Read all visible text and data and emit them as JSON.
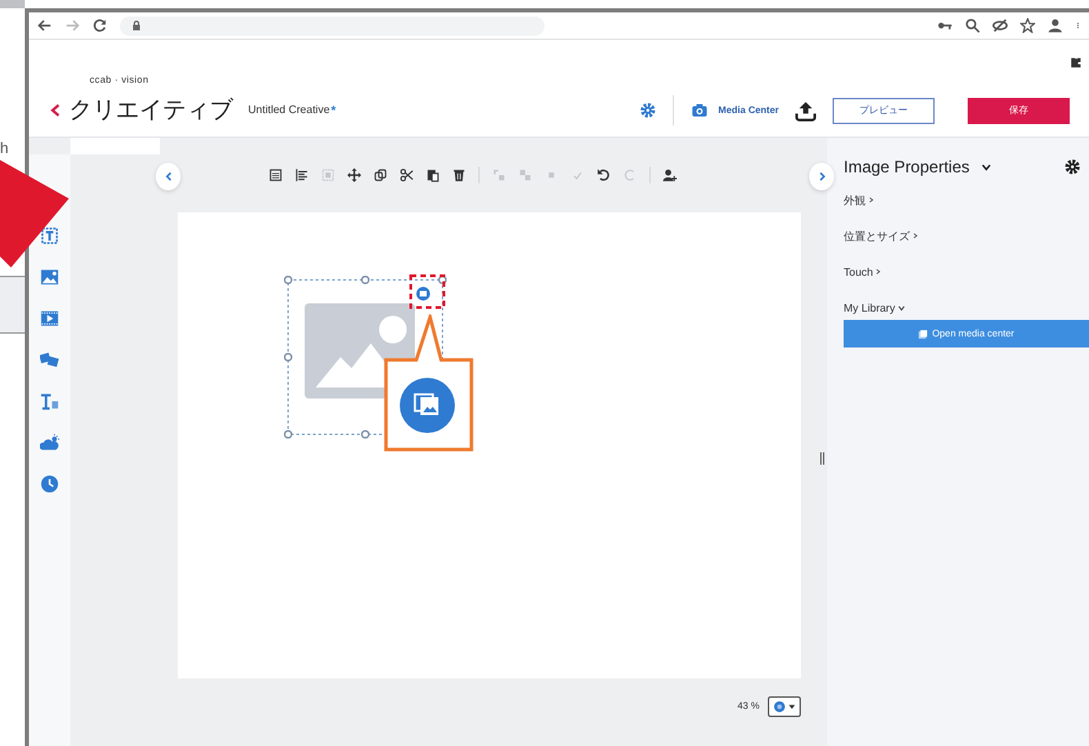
{
  "backdrop": {
    "text": "h"
  },
  "app_header": {
    "logo": "ccab · vision",
    "title": "クリエイティブ",
    "document_name": "Untitled Creative",
    "unsaved_mark": "*",
    "media_center": "Media Center",
    "preview_button": "プレビュー",
    "save_button": "保存"
  },
  "toolbar": {
    "tools": [
      {
        "kind": "list",
        "disabled": false
      },
      {
        "kind": "align",
        "disabled": false
      },
      {
        "kind": "group",
        "disabled": true
      },
      {
        "kind": "move",
        "disabled": false
      },
      {
        "kind": "copy",
        "disabled": false
      },
      {
        "kind": "cut",
        "disabled": false
      },
      {
        "kind": "paste",
        "disabled": false
      },
      {
        "kind": "delete",
        "disabled": false
      },
      {
        "kind": "separator"
      },
      {
        "kind": "forward",
        "disabled": true
      },
      {
        "kind": "backward",
        "disabled": true
      },
      {
        "kind": "square",
        "disabled": true
      },
      {
        "kind": "check",
        "disabled": true
      },
      {
        "kind": "undo",
        "disabled": false
      },
      {
        "kind": "redo",
        "disabled": true
      },
      {
        "kind": "separator"
      },
      {
        "kind": "user",
        "disabled": false
      }
    ]
  },
  "sidebar": {
    "tools": [
      {
        "kind": "text-frame"
      },
      {
        "kind": "image"
      },
      {
        "kind": "video"
      },
      {
        "kind": "slides"
      },
      {
        "kind": "text"
      },
      {
        "kind": "weather"
      },
      {
        "kind": "clock"
      }
    ]
  },
  "zoom": {
    "reading": "43 %"
  },
  "properties": {
    "title": "Image Properties",
    "sections": [
      {
        "label": "外観",
        "expanded": false
      },
      {
        "label": "位置とサイズ",
        "expanded": false
      },
      {
        "label": "Touch",
        "expanded": false
      },
      {
        "label": "My Library",
        "expanded": true
      }
    ],
    "open_button": "Open media center"
  }
}
